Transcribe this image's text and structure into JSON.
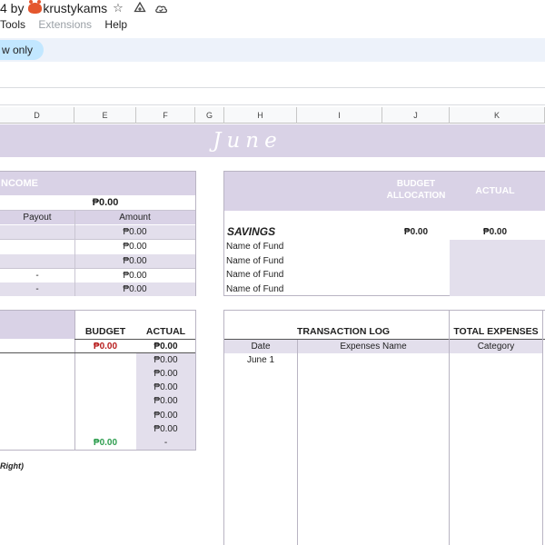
{
  "header": {
    "title_prefix": "4 by ",
    "title_user": "krustykams",
    "icons": [
      "star-icon",
      "move-to-drive-icon",
      "cloud-status-icon"
    ]
  },
  "menu": {
    "tools": "Tools",
    "extensions": "Extensions",
    "help": "Help"
  },
  "toolbar": {
    "mode": "w only"
  },
  "columns": [
    "D",
    "E",
    "F",
    "G",
    "H",
    "I",
    "J",
    "K"
  ],
  "banner": {
    "month": "June"
  },
  "income": {
    "title": "NCOME",
    "total": "₱0.00",
    "col_payout": "Payout",
    "col_amount": "Amount",
    "rows": [
      {
        "payout": "",
        "amount": "₱0.00"
      },
      {
        "payout": "",
        "amount": "₱0.00"
      },
      {
        "payout": "",
        "amount": "₱0.00"
      },
      {
        "payout": "-",
        "amount": "₱0.00"
      },
      {
        "payout": "-",
        "amount": "₱0.00"
      }
    ]
  },
  "savings_panel": {
    "col_budget": "BUDGET ALLOCATION",
    "col_actual": "ACTUAL",
    "label": "SAVINGS",
    "budget": "₱0.00",
    "actual": "₱0.00",
    "funds": [
      "Name of Fund",
      "Name of Fund",
      "Name of Fund",
      "Name of Fund"
    ]
  },
  "expenses": {
    "col_budget": "BUDGET",
    "col_actual": "ACTUAL",
    "budget_total": "₱0.00",
    "actual_total": "₱0.00",
    "actual_rows": [
      "₱0.00",
      "₱0.00",
      "₱0.00",
      "₱0.00",
      "₱0.00",
      "₱0.00"
    ],
    "footer_budget": "₱0.00",
    "footer_actual": "-",
    "note": "Right)"
  },
  "log": {
    "title": "TRANSACTION LOG",
    "total_label": "TOTAL EXPENSES",
    "col_date": "Date",
    "col_name": "Expenses Name",
    "col_category": "Category",
    "first_date": "June 1"
  },
  "colors": {
    "lavender_header": "#d9d2e6",
    "lavender_cell": "#e3dfec",
    "toolbar_bg": "#edf2fa",
    "pill_bg": "#c2e7ff"
  }
}
